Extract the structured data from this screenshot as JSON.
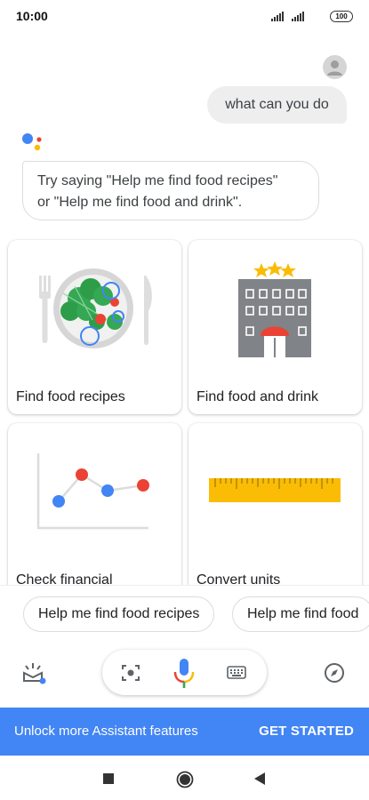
{
  "status_bar": {
    "time": "10:00",
    "battery": "100"
  },
  "conversation": {
    "user_query": "what can you do",
    "assistant_reply_line1": "Try saying \"Help me find food recipes\"",
    "assistant_reply_line2": "or \"Help me find food and drink\"."
  },
  "cards": [
    {
      "label": "Find food recipes",
      "icon": "plate-food-icon"
    },
    {
      "label": "Find food and drink",
      "icon": "hotel-building-icon"
    },
    {
      "label": "Check financial",
      "icon": "line-chart-icon"
    },
    {
      "label": "Convert units",
      "icon": "ruler-icon"
    }
  ],
  "chips": [
    {
      "label": "Help me find food recipes"
    },
    {
      "label": "Help me find food"
    }
  ],
  "controls": {
    "left_icon": "explore-updates-icon",
    "lens_icon": "lens-icon",
    "mic_icon": "mic-icon",
    "keyboard_icon": "keyboard-icon",
    "right_icon": "compass-icon"
  },
  "banner": {
    "text": "Unlock more Assistant features",
    "button": "GET STARTED",
    "color": "#4285f4"
  },
  "nav": {
    "recent_icon": "square-icon",
    "home_icon": "circle-icon",
    "back_icon": "triangle-back-icon"
  },
  "colors": {
    "google_blue": "#4285f4",
    "google_red": "#ea4335",
    "google_yellow": "#fbbc05",
    "google_green": "#34a853"
  }
}
